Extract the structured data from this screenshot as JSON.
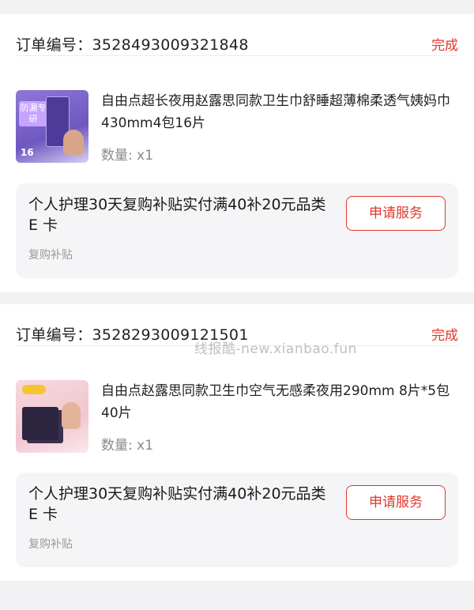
{
  "orders": [
    {
      "order_label": "订单编号：3528493009321848",
      "status": "完成",
      "product": {
        "title": "自由点超长夜用赵露思同款卫生巾舒睡超薄棉柔透气姨妈巾430mm4包16片",
        "quantity": "数量: x1"
      },
      "subsidy": {
        "text": "个人护理30天复购补贴实付满40补20元品类 E 卡",
        "tag": "复购补贴",
        "button": "申请服务"
      }
    },
    {
      "order_label": "订单编号：3528293009121501",
      "status": "完成",
      "product": {
        "title": "自由点赵露思同款卫生巾空气无感柔夜用290mm 8片*5包 40片",
        "quantity": "数量: x1"
      },
      "subsidy": {
        "text": "个人护理30天复购补贴实付满40补20元品类 E 卡",
        "tag": "复购补贴",
        "button": "申请服务"
      }
    }
  ],
  "thumb_1": {
    "tag": "防漏专研",
    "count": "16"
  },
  "watermark": "线报酷-new.xianbao.fun",
  "colors": {
    "accent": "#e0372c",
    "background": "#f2f2f4",
    "subsidy_box": "#f5f5f7"
  }
}
